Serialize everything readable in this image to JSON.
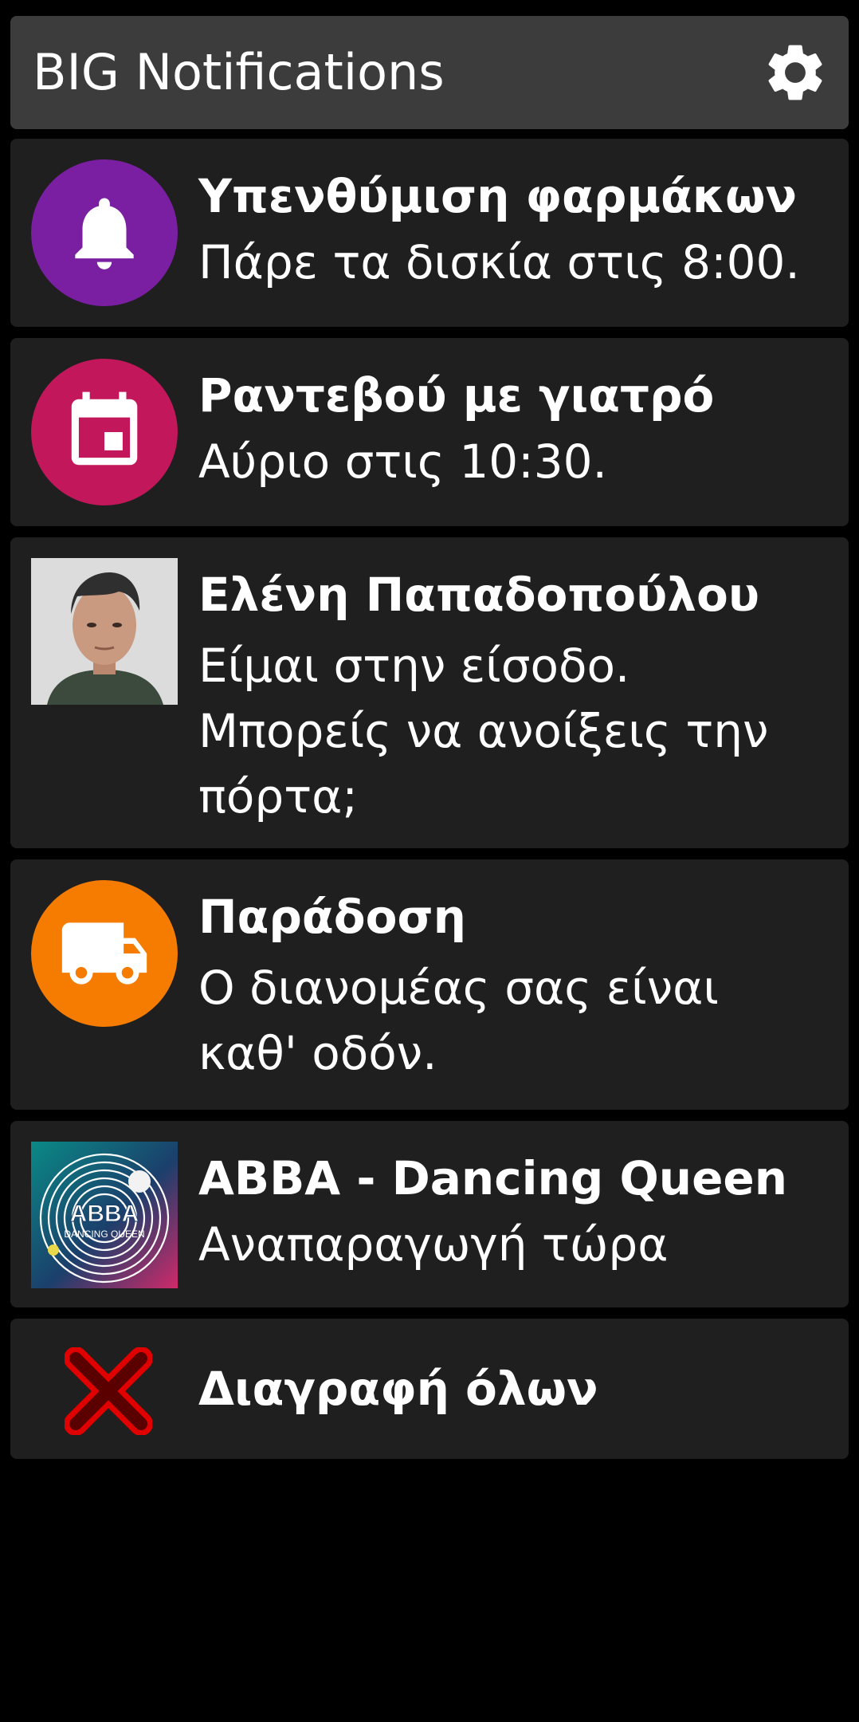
{
  "app": {
    "title": "BIG Notifications",
    "settings_icon": "gear-icon"
  },
  "notifications": [
    {
      "icon": "bell-icon",
      "icon_bg": "#7b1fa2",
      "title": "Υπενθύμιση φαρμάκων",
      "body": "Πάρε τα δισκία στις 8:00."
    },
    {
      "icon": "calendar-icon",
      "icon_bg": "#c2185b",
      "title": "Ραντεβού με γιατρό",
      "body": "Αύριο στις 10:30."
    },
    {
      "icon": "contact-photo",
      "title": "Ελένη Παπαδοπούλου",
      "body": "Είμαι στην είσοδο. Μπορείς να ανοίξεις την πόρτα;"
    },
    {
      "icon": "truck-icon",
      "icon_bg": "#f57c00",
      "title": "Παράδοση",
      "body": "Ο διανομέας σας είναι καθ' οδόν."
    },
    {
      "icon": "album-art",
      "album_text": "ABBA",
      "album_subtext": "DANCING QUEEN",
      "title": "ABBA - Dancing Queen",
      "body": "Αναπαραγωγή τώρα"
    }
  ],
  "clear_all": {
    "icon": "close-icon",
    "label": "Διαγραφή όλων",
    "icon_color": "#e00000"
  }
}
